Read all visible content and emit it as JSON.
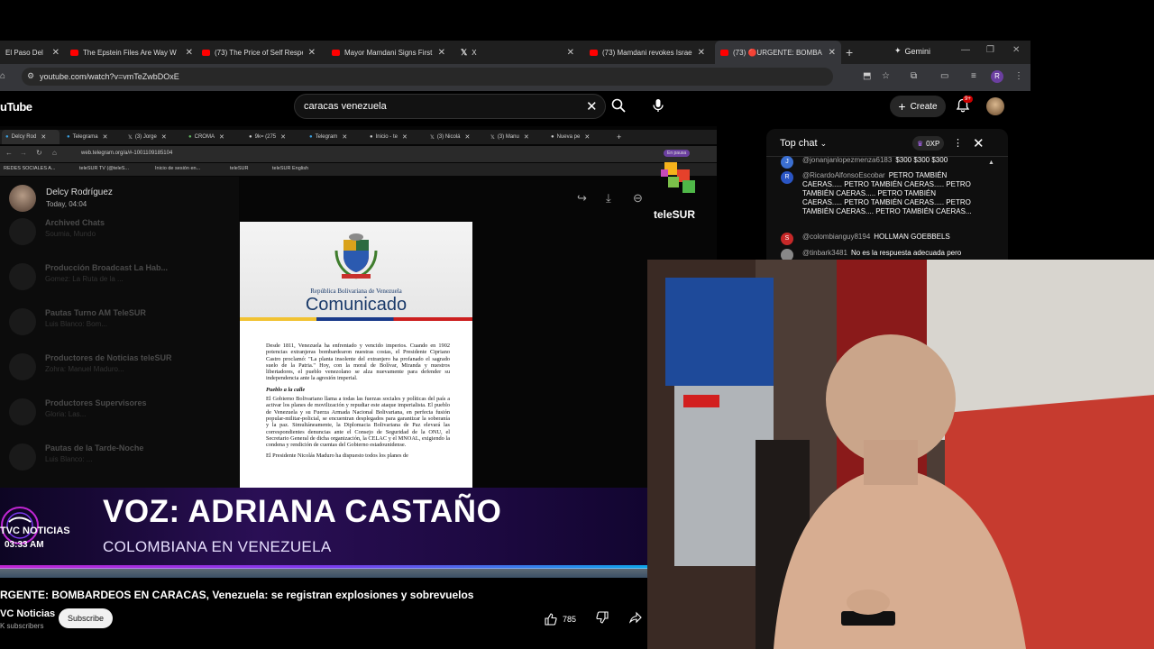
{
  "browser": {
    "tabs": [
      {
        "title": "El Paso Del",
        "icon": "youtube"
      },
      {
        "title": "The Epstein Files Are Way W",
        "icon": "youtube"
      },
      {
        "title": "(73) The Price of Self Respec",
        "icon": "youtube"
      },
      {
        "title": "Mayor Mamdani Signs First",
        "icon": "youtube"
      },
      {
        "title": "X",
        "icon": "x"
      },
      {
        "title": "(73) Mamdani revokes Israel",
        "icon": "youtube"
      },
      {
        "title": "(73) 🔴URGENTE: BOMBA",
        "icon": "youtube"
      }
    ],
    "gemini_label": "Gemini",
    "url": "youtube.com/watch?v=vmTeZwbDOxE",
    "profile_initial": "R"
  },
  "youtube": {
    "logo_text": "uTube",
    "search_value": "caracas venezuela",
    "create_label": "Create",
    "notif_count": "9+"
  },
  "video": {
    "inner_tabs": [
      "Delcy Rod",
      "Telegrama",
      "(3) Jorge",
      "CROMA",
      "9k= (275",
      "Telegram",
      "Inicio - te",
      "(3) Nicolá",
      "(3) Manu",
      "Nueva pe"
    ],
    "inner_url": "web.telegram.org/a/#-1001109185104",
    "inner_pause": "En pausa",
    "bookmarks": [
      "REDES SOCIALES A...",
      "teleSUR TV (@teleS...",
      "Inicio de sesión en...",
      "teleSUR",
      "teleSUR English"
    ],
    "sidebar_chats": [
      {
        "name": "Archived Chats",
        "preview": "Soumia, Mundo"
      },
      {
        "name": "Producción Broadcast La Hab...",
        "preview": "Gomez: La Ruta de la ..."
      },
      {
        "name": "Pautas Turno AM TeleSUR",
        "preview": "Luis Blanco: Bom..."
      },
      {
        "name": "Productores de Noticias teleSUR",
        "preview": "Zohra: Manuel Maduro..."
      },
      {
        "name": "Productores Supervisores",
        "preview": "Gloria: Las..."
      },
      {
        "name": "Pautas de la Tarde-Noche",
        "preview": "Luis Blanco: ..."
      }
    ],
    "sender_name": "Delcy Rodríguez",
    "sender_time": "Today, 04:04",
    "telesur_logo": "teleSUR",
    "document": {
      "republic": "República Bolivariana de Venezuela",
      "title": "Comunicado",
      "para1": "Desde 1811, Venezuela ha enfrentado y vencido imperios. Cuando en 1902 potencias extranjeras bombardearon nuestras costas, el Presidente Cipriano Castro proclamó: \"La planta insolente del extranjero ha profanado el sagrado suelo de la Patria.\" Hoy, con la moral de Bolívar, Miranda y nuestros libertadores, el pueblo venezolano se alza nuevamente para defender su independencia ante la agresión imperial.",
      "subhead": "Pueblo a la calle",
      "para2": "El Gobierno Bolivariano llama a todas las fuerzas sociales y políticas del país a activar los planes de movilización y repudiar este ataque imperialista. El pueblo de Venezuela y su Fuerza Armada Nacional Bolivariana, en perfecta fusión popular-militar-policial, se encuentran desplegados para garantizar la soberanía y la paz. Simultáneamente, la Diplomacia Bolivariana de Paz elevará las correspondientes denuncias ante el Consejo de Seguridad de la ONU, el Secretario General de dicha organización, la CELAC y el MNOAL, exigiendo la condena y rendición de cuentas del Gobierno estadounidense.",
      "para3": "El Presidente Nicolás Maduro ha dispuesto todos los planes de"
    },
    "lower_third_title": "VOZ: ADRIANA CASTAÑO",
    "lower_third_sub": "COLOMBIANA EN VENEZUELA",
    "channel_logo_name": "TVC NOTICIAS",
    "channel_logo_time": "03:33 AM"
  },
  "watch": {
    "title": "RGENTE: BOMBARDEOS EN CARACAS, Venezuela: se registran explosiones y sobrevuelos",
    "channel": "VC Noticias",
    "subscribers": "K subscribers",
    "subscribe_label": "Subscribe",
    "likes": "785"
  },
  "chat": {
    "header": "Top chat",
    "points": "0XP",
    "messages": [
      {
        "author": "@jonanjanlopezmenza6183",
        "text": "$300 $300 $300",
        "initial": "J",
        "color": "#3b6fd1"
      },
      {
        "author": "@RicardoAlfonsoEscobar",
        "text": "PETRO TAMBIÉN CAERAS..... PETRO TAMBIÉN CAERAS..... PETRO TAMBIÉN CAERAS..... PETRO TAMBIÉN CAERAS..... PETRO TAMBIÉN CAERAS..... PETRO TAMBIÉN CAERAS.... PETRO TAMBIÉN CAERAS...",
        "initial": "R",
        "color": "#2a55c4"
      },
      {
        "author": "@colombianguy8194",
        "text": "HOLLMAN GOEBBELS",
        "initial": "S",
        "color": "#c62828"
      },
      {
        "author": "@tinbark3481",
        "text": "No es la respuesta adecuada pero",
        "initial": "",
        "color": "#888888"
      }
    ]
  }
}
